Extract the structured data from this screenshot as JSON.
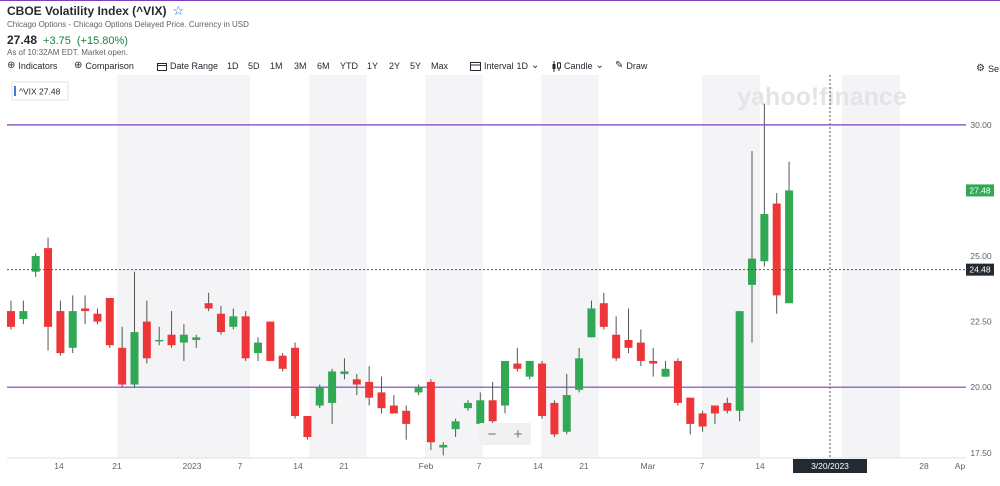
{
  "header": {
    "title": "CBOE Volatility Index (^VIX)",
    "subtitle": "Chicago Options - Chicago Options Delayed Price. Currency in USD",
    "price": "27.48",
    "change": "+3.75",
    "change_pct": "(+15.80%)",
    "as_of": "As of 10:32AM EDT. Market open.",
    "change_color": "#1a8245"
  },
  "toolbar": {
    "indicators": "Indicators",
    "comparison": "Comparison",
    "date_range": "Date Range",
    "ranges": [
      "1D",
      "5D",
      "1M",
      "3M",
      "6M",
      "YTD",
      "1Y",
      "2Y",
      "5Y",
      "Max"
    ],
    "interval_label": "Interval",
    "interval_value": "1D",
    "chart_type": "Candle",
    "draw": "Draw",
    "settings": "Se"
  },
  "chart": {
    "legend": "^VIX 27.48",
    "watermark": "yahoo!finance",
    "current_price_label": "27.48",
    "crosshair_price_label": "24.48",
    "crosshair_date_label": "3/20/2023",
    "zoom_out": "−",
    "zoom_in": "+",
    "up_color": "#31a954",
    "down_color": "#ee3538",
    "hline_color": "#7b3fbf"
  },
  "chart_data": {
    "type": "candlestick",
    "y_ticks": [
      "30.00",
      "27.50",
      "25.00",
      "22.50",
      "20.00",
      "17.50"
    ],
    "ylim": [
      17.3,
      31.9
    ],
    "horizontal_lines": [
      30.0,
      20.0
    ],
    "crosshair_y": 24.48,
    "x_ticks": [
      "14",
      "21",
      "2023",
      "7",
      "14",
      "21",
      "Feb",
      "7",
      "14",
      "21",
      "Mar",
      "7",
      "14",
      "21",
      "28",
      "Ap"
    ],
    "candles": [
      {
        "o": 22.9,
        "h": 23.3,
        "l": 22.2,
        "c": 22.3
      },
      {
        "o": 22.6,
        "h": 23.3,
        "l": 22.4,
        "c": 22.9
      },
      {
        "o": 24.4,
        "h": 25.1,
        "l": 24.2,
        "c": 25.0
      },
      {
        "o": 25.3,
        "h": 25.7,
        "l": 21.4,
        "c": 22.3
      },
      {
        "o": 22.9,
        "h": 23.3,
        "l": 21.2,
        "c": 21.3
      },
      {
        "o": 21.5,
        "h": 23.5,
        "l": 21.3,
        "c": 22.9
      },
      {
        "o": 23.0,
        "h": 23.5,
        "l": 22.4,
        "c": 22.9
      },
      {
        "o": 22.8,
        "h": 23.0,
        "l": 22.4,
        "c": 22.5
      },
      {
        "o": 23.4,
        "h": 23.4,
        "l": 21.5,
        "c": 21.6
      },
      {
        "o": 21.5,
        "h": 22.3,
        "l": 20.0,
        "c": 20.1
      },
      {
        "o": 20.1,
        "h": 24.4,
        "l": 20.0,
        "c": 22.1
      },
      {
        "o": 22.5,
        "h": 23.3,
        "l": 20.9,
        "c": 21.1
      },
      {
        "o": 21.8,
        "h": 22.3,
        "l": 21.6,
        "c": 21.8
      },
      {
        "o": 22.0,
        "h": 22.9,
        "l": 21.5,
        "c": 21.6
      },
      {
        "o": 21.7,
        "h": 22.4,
        "l": 21.0,
        "c": 22.0
      },
      {
        "o": 21.8,
        "h": 22.0,
        "l": 21.5,
        "c": 21.9
      },
      {
        "o": 23.2,
        "h": 23.6,
        "l": 22.9,
        "c": 23.0
      },
      {
        "o": 22.8,
        "h": 23.1,
        "l": 22.0,
        "c": 22.1
      },
      {
        "o": 22.3,
        "h": 23.0,
        "l": 22.2,
        "c": 22.7
      },
      {
        "o": 22.7,
        "h": 22.9,
        "l": 21.0,
        "c": 21.1
      },
      {
        "o": 21.3,
        "h": 21.9,
        "l": 21.0,
        "c": 21.7
      },
      {
        "o": 22.5,
        "h": 22.5,
        "l": 21.0,
        "c": 21.0
      },
      {
        "o": 21.2,
        "h": 21.3,
        "l": 20.6,
        "c": 20.7
      },
      {
        "o": 21.5,
        "h": 21.7,
        "l": 18.8,
        "c": 18.9
      },
      {
        "o": 18.9,
        "h": 18.9,
        "l": 18.0,
        "c": 18.1
      },
      {
        "o": 19.3,
        "h": 20.1,
        "l": 19.2,
        "c": 20.0
      },
      {
        "o": 19.4,
        "h": 20.7,
        "l": 18.6,
        "c": 20.6
      },
      {
        "o": 20.5,
        "h": 21.1,
        "l": 20.3,
        "c": 20.6
      },
      {
        "o": 20.3,
        "h": 20.5,
        "l": 19.7,
        "c": 20.1
      },
      {
        "o": 20.2,
        "h": 20.8,
        "l": 19.3,
        "c": 19.6
      },
      {
        "o": 19.8,
        "h": 20.4,
        "l": 19.0,
        "c": 19.2
      },
      {
        "o": 19.3,
        "h": 19.7,
        "l": 19.0,
        "c": 19.0
      },
      {
        "o": 19.1,
        "h": 19.3,
        "l": 18.0,
        "c": 18.6
      },
      {
        "o": 19.8,
        "h": 20.1,
        "l": 19.7,
        "c": 20.0
      },
      {
        "o": 20.2,
        "h": 20.3,
        "l": 17.6,
        "c": 17.9
      },
      {
        "o": 17.7,
        "h": 17.9,
        "l": 17.4,
        "c": 17.8
      },
      {
        "o": 18.4,
        "h": 18.8,
        "l": 18.1,
        "c": 18.7
      },
      {
        "o": 19.2,
        "h": 19.5,
        "l": 19.1,
        "c": 19.4
      },
      {
        "o": 18.6,
        "h": 19.8,
        "l": 18.3,
        "c": 19.5
      },
      {
        "o": 19.5,
        "h": 20.2,
        "l": 18.6,
        "c": 18.7
      },
      {
        "o": 19.3,
        "h": 20.9,
        "l": 19.0,
        "c": 21.0
      },
      {
        "o": 20.9,
        "h": 21.5,
        "l": 20.6,
        "c": 20.7
      },
      {
        "o": 20.4,
        "h": 21.0,
        "l": 20.3,
        "c": 21.0
      },
      {
        "o": 20.9,
        "h": 21.0,
        "l": 18.8,
        "c": 18.9
      },
      {
        "o": 19.4,
        "h": 19.5,
        "l": 18.1,
        "c": 18.2
      },
      {
        "o": 18.3,
        "h": 20.5,
        "l": 18.2,
        "c": 19.7
      },
      {
        "o": 19.9,
        "h": 21.5,
        "l": 19.8,
        "c": 21.1
      },
      {
        "o": 21.9,
        "h": 23.3,
        "l": 21.9,
        "c": 23.0
      },
      {
        "o": 23.2,
        "h": 23.6,
        "l": 22.2,
        "c": 22.3
      },
      {
        "o": 22.0,
        "h": 22.7,
        "l": 21.0,
        "c": 21.1
      },
      {
        "o": 21.8,
        "h": 23.0,
        "l": 21.3,
        "c": 21.5
      },
      {
        "o": 21.7,
        "h": 22.2,
        "l": 20.8,
        "c": 21.0
      },
      {
        "o": 21.0,
        "h": 21.5,
        "l": 20.4,
        "c": 20.9
      },
      {
        "o": 20.4,
        "h": 21.0,
        "l": 20.4,
        "c": 20.7
      },
      {
        "o": 21.0,
        "h": 21.1,
        "l": 19.3,
        "c": 19.4
      },
      {
        "o": 19.6,
        "h": 19.6,
        "l": 18.2,
        "c": 18.6
      },
      {
        "o": 19.0,
        "h": 19.1,
        "l": 18.3,
        "c": 18.5
      },
      {
        "o": 19.3,
        "h": 19.3,
        "l": 18.6,
        "c": 19.0
      },
      {
        "o": 19.4,
        "h": 19.6,
        "l": 19.0,
        "c": 19.1
      },
      {
        "o": 19.1,
        "h": 22.5,
        "l": 18.7,
        "c": 22.9
      },
      {
        "o": 23.9,
        "h": 29.0,
        "l": 21.7,
        "c": 24.9
      },
      {
        "o": 24.8,
        "h": 30.8,
        "l": 24.6,
        "c": 26.6
      },
      {
        "o": 27.0,
        "h": 27.4,
        "l": 22.8,
        "c": 23.5
      },
      {
        "o": 23.2,
        "h": 28.6,
        "l": 23.2,
        "c": 27.5
      }
    ]
  }
}
